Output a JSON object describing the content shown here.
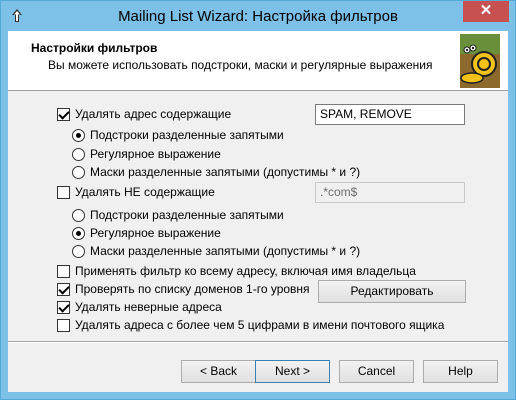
{
  "window": {
    "title": "Mailing List Wizard: Настройка фильтров",
    "close_glyph": "✕"
  },
  "header": {
    "title": "Настройки фильтров",
    "subtitle": "Вы можете использовать подстроки, маски и регулярные выражения"
  },
  "filter_contains": {
    "label": "Удалять адрес содержащие",
    "checked": true,
    "value": "SPAM, REMOVE",
    "options": [
      {
        "label": "Подстроки разделенные запятыми",
        "selected": true
      },
      {
        "label": "Регулярное выражение",
        "selected": false
      },
      {
        "label": "Маски разделенные запятыми (допустимы * и ?)",
        "selected": false
      }
    ]
  },
  "filter_not_contains": {
    "label": "Удалять НЕ содержащие",
    "checked": false,
    "value": ".*com$",
    "options": [
      {
        "label": "Подстроки разделенные запятыми",
        "selected": false
      },
      {
        "label": "Регулярное выражение",
        "selected": true
      },
      {
        "label": "Маски разделенные запятыми (допустимы * и ?)",
        "selected": false
      }
    ]
  },
  "options": {
    "apply_full_address": {
      "label": "Применять фильтр ко всему адресу, включая имя владельца",
      "checked": false
    },
    "check_tld": {
      "label": "Проверять по списку доменов 1-го уровня",
      "checked": true
    },
    "edit_button": "Редактировать",
    "remove_invalid": {
      "label": "Удалять неверные адреса",
      "checked": true
    },
    "remove_many_digits": {
      "label": "Удалять адреса с более чем 5 цифрами в имени почтового ящика",
      "checked": false
    }
  },
  "footer": {
    "back": "< Back",
    "next": "Next >",
    "cancel": "Cancel",
    "help": "Help"
  },
  "colors": {
    "title_bar": "#7dc0e8",
    "close_button": "#c75050"
  }
}
